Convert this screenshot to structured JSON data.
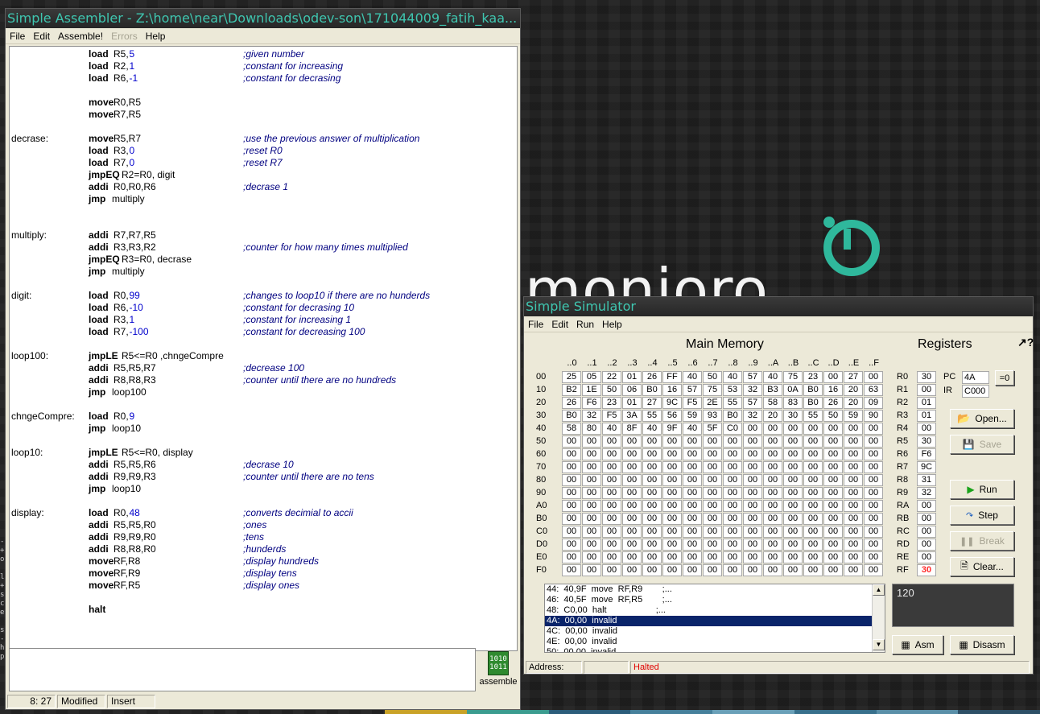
{
  "desktop": {
    "wallpaper_text": "monjoro",
    "taskbar_colors": [
      "#c9a227",
      "#3b9c8f",
      "#2b5d7a",
      "#46809b",
      "#6aa0b8",
      "#38708c",
      "#5a8fa8",
      "#2d4f66"
    ]
  },
  "assembler": {
    "title": "Simple Assembler - Z:\\home\\near\\Downloads\\odev-son\\171044009_fatih_kaa...",
    "menu": [
      "File",
      "Edit",
      "Assemble!",
      "Errors",
      "Help"
    ],
    "code": [
      {
        "label": "",
        "op": "load",
        "args": "R5,",
        "num": "5",
        "comment": ";given number"
      },
      {
        "label": "",
        "op": "load",
        "args": "R2,",
        "num": "1",
        "comment": ";constant for increasing"
      },
      {
        "label": "",
        "op": "load",
        "args": "R6,",
        "num": "-1",
        "comment": ";constant for decrasing"
      },
      {
        "label": "",
        "op": "",
        "args": "",
        "num": "",
        "comment": ""
      },
      {
        "label": "",
        "op": "move",
        "args": "R0,R5",
        "num": "",
        "comment": ""
      },
      {
        "label": "",
        "op": "move",
        "args": "R7,R5",
        "num": "",
        "comment": ""
      },
      {
        "label": "",
        "op": "",
        "args": "",
        "num": "",
        "comment": ""
      },
      {
        "label": "decrase:",
        "op": "move",
        "args": "R5,R7",
        "num": "",
        "comment": ";use the previous answer of multiplication"
      },
      {
        "label": "",
        "op": "load",
        "args": "R3,",
        "num": "0",
        "comment": ";reset R0"
      },
      {
        "label": "",
        "op": "load",
        "args": "R7,",
        "num": "0",
        "comment": ";reset R7"
      },
      {
        "label": "",
        "op": "jmpEQ",
        "args": "R2=R0, digit",
        "num": "",
        "comment": ""
      },
      {
        "label": "",
        "op": "addi",
        "args": "R0,R0,R6",
        "num": "",
        "comment": ";decrase 1"
      },
      {
        "label": "",
        "op": "jmp",
        "args": "multiply",
        "num": "",
        "comment": ""
      },
      {
        "label": "",
        "op": "",
        "args": "",
        "num": "",
        "comment": ""
      },
      {
        "label": "",
        "op": "",
        "args": "",
        "num": "",
        "comment": ""
      },
      {
        "label": "multiply:",
        "op": "addi",
        "args": "R7,R7,R5",
        "num": "",
        "comment": ""
      },
      {
        "label": "",
        "op": "addi",
        "args": "R3,R3,R2",
        "num": "",
        "comment": ";counter for how many times multiplied"
      },
      {
        "label": "",
        "op": "jmpEQ",
        "args": "R3=R0, decrase",
        "num": "",
        "comment": ""
      },
      {
        "label": "",
        "op": "jmp",
        "args": "multiply",
        "num": "",
        "comment": ""
      },
      {
        "label": "",
        "op": "",
        "args": "",
        "num": "",
        "comment": ""
      },
      {
        "label": "digit:",
        "op": "load",
        "args": "R0,",
        "num": "99",
        "comment": ";changes to loop10 if there are no hunderds"
      },
      {
        "label": "",
        "op": "load",
        "args": "R6,",
        "num": "-10",
        "comment": ";constant for decrasing 10"
      },
      {
        "label": "",
        "op": "load",
        "args": "R3,",
        "num": "1",
        "comment": ";constant for increasing 1"
      },
      {
        "label": "",
        "op": "load",
        "args": "R7,",
        "num": "-100",
        "comment": ";constant for decreasing 100"
      },
      {
        "label": "",
        "op": "",
        "args": "",
        "num": "",
        "comment": ""
      },
      {
        "label": "loop100:",
        "op": "jmpLE",
        "args": "R5<=R0 ,chngeCompre",
        "num": "",
        "comment": ""
      },
      {
        "label": "",
        "op": "addi",
        "args": "R5,R5,R7",
        "num": "",
        "comment": ";decrease 100"
      },
      {
        "label": "",
        "op": "addi",
        "args": "R8,R8,R3",
        "num": "",
        "comment": ";counter until there are no hundreds"
      },
      {
        "label": "",
        "op": "jmp",
        "args": "loop100",
        "num": "",
        "comment": ""
      },
      {
        "label": "",
        "op": "",
        "args": "",
        "num": "",
        "comment": ""
      },
      {
        "label": "chngeCompre:",
        "op": "load",
        "args": "R0,",
        "num": "9",
        "comment": ""
      },
      {
        "label": "",
        "op": "jmp",
        "args": "loop10",
        "num": "",
        "comment": ""
      },
      {
        "label": "",
        "op": "",
        "args": "",
        "num": "",
        "comment": ""
      },
      {
        "label": "loop10:",
        "op": "jmpLE",
        "args": "R5<=R0, display",
        "num": "",
        "comment": ""
      },
      {
        "label": "",
        "op": "addi",
        "args": "R5,R5,R6",
        "num": "",
        "comment": ";decrase 10"
      },
      {
        "label": "",
        "op": "addi",
        "args": "R9,R9,R3",
        "num": "",
        "comment": ";counter until there are no tens"
      },
      {
        "label": "",
        "op": "jmp",
        "args": "loop10",
        "num": "",
        "comment": ""
      },
      {
        "label": "",
        "op": "",
        "args": "",
        "num": "",
        "comment": ""
      },
      {
        "label": "display:",
        "op": "load",
        "args": "R0,",
        "num": "48",
        "comment": ";converts decimial to accii"
      },
      {
        "label": "",
        "op": "addi",
        "args": "R5,R5,R0",
        "num": "",
        "comment": ";ones"
      },
      {
        "label": "",
        "op": "addi",
        "args": "R9,R9,R0",
        "num": "",
        "comment": ";tens"
      },
      {
        "label": "",
        "op": "addi",
        "args": "R8,R8,R0",
        "num": "",
        "comment": ";hunderds"
      },
      {
        "label": "",
        "op": "move",
        "args": "RF,R8",
        "num": "",
        "comment": ";display hundreds"
      },
      {
        "label": "",
        "op": "move",
        "args": "RF,R9",
        "num": "",
        "comment": ";display tens"
      },
      {
        "label": "",
        "op": "move",
        "args": "RF,R5",
        "num": "",
        "comment": ";display ones"
      },
      {
        "label": "",
        "op": "",
        "args": "",
        "num": "",
        "comment": ""
      },
      {
        "label": "",
        "op": "halt",
        "args": "",
        "num": "",
        "comment": ""
      }
    ],
    "assemble_label": "assemble",
    "status": {
      "position": "8: 27",
      "modified": "Modified",
      "mode": "Insert"
    }
  },
  "simulator": {
    "title": "Simple Simulator",
    "menu": [
      "File",
      "Edit",
      "Run",
      "Help"
    ],
    "memory_title": "Main Memory",
    "registers_title": "Registers",
    "col_headers": [
      "..0",
      "..1",
      "..2",
      "..3",
      "..4",
      "..5",
      "..6",
      "..7",
      "..8",
      "..9",
      "..A",
      "..B",
      "..C",
      "..D",
      "..E",
      "..F"
    ],
    "row_labels": [
      "00",
      "10",
      "20",
      "30",
      "40",
      "50",
      "60",
      "70",
      "80",
      "90",
      "A0",
      "B0",
      "C0",
      "D0",
      "E0",
      "F0"
    ],
    "memory": [
      [
        "25",
        "05",
        "22",
        "01",
        "26",
        "FF",
        "40",
        "50",
        "40",
        "57",
        "40",
        "75",
        "23",
        "00",
        "27",
        "00"
      ],
      [
        "B2",
        "1E",
        "50",
        "06",
        "B0",
        "16",
        "57",
        "75",
        "53",
        "32",
        "B3",
        "0A",
        "B0",
        "16",
        "20",
        "63"
      ],
      [
        "26",
        "F6",
        "23",
        "01",
        "27",
        "9C",
        "F5",
        "2E",
        "55",
        "57",
        "58",
        "83",
        "B0",
        "26",
        "20",
        "09"
      ],
      [
        "B0",
        "32",
        "F5",
        "3A",
        "55",
        "56",
        "59",
        "93",
        "B0",
        "32",
        "20",
        "30",
        "55",
        "50",
        "59",
        "90"
      ],
      [
        "58",
        "80",
        "40",
        "8F",
        "40",
        "9F",
        "40",
        "5F",
        "C0",
        "00",
        "00",
        "00",
        "00",
        "00",
        "00",
        "00"
      ],
      [
        "00",
        "00",
        "00",
        "00",
        "00",
        "00",
        "00",
        "00",
        "00",
        "00",
        "00",
        "00",
        "00",
        "00",
        "00",
        "00"
      ],
      [
        "00",
        "00",
        "00",
        "00",
        "00",
        "00",
        "00",
        "00",
        "00",
        "00",
        "00",
        "00",
        "00",
        "00",
        "00",
        "00"
      ],
      [
        "00",
        "00",
        "00",
        "00",
        "00",
        "00",
        "00",
        "00",
        "00",
        "00",
        "00",
        "00",
        "00",
        "00",
        "00",
        "00"
      ],
      [
        "00",
        "00",
        "00",
        "00",
        "00",
        "00",
        "00",
        "00",
        "00",
        "00",
        "00",
        "00",
        "00",
        "00",
        "00",
        "00"
      ],
      [
        "00",
        "00",
        "00",
        "00",
        "00",
        "00",
        "00",
        "00",
        "00",
        "00",
        "00",
        "00",
        "00",
        "00",
        "00",
        "00"
      ],
      [
        "00",
        "00",
        "00",
        "00",
        "00",
        "00",
        "00",
        "00",
        "00",
        "00",
        "00",
        "00",
        "00",
        "00",
        "00",
        "00"
      ],
      [
        "00",
        "00",
        "00",
        "00",
        "00",
        "00",
        "00",
        "00",
        "00",
        "00",
        "00",
        "00",
        "00",
        "00",
        "00",
        "00"
      ],
      [
        "00",
        "00",
        "00",
        "00",
        "00",
        "00",
        "00",
        "00",
        "00",
        "00",
        "00",
        "00",
        "00",
        "00",
        "00",
        "00"
      ],
      [
        "00",
        "00",
        "00",
        "00",
        "00",
        "00",
        "00",
        "00",
        "00",
        "00",
        "00",
        "00",
        "00",
        "00",
        "00",
        "00"
      ],
      [
        "00",
        "00",
        "00",
        "00",
        "00",
        "00",
        "00",
        "00",
        "00",
        "00",
        "00",
        "00",
        "00",
        "00",
        "00",
        "00"
      ],
      [
        "00",
        "00",
        "00",
        "00",
        "00",
        "00",
        "00",
        "00",
        "00",
        "00",
        "00",
        "00",
        "00",
        "00",
        "00",
        "00"
      ]
    ],
    "registers": [
      {
        "name": "R0",
        "value": "30"
      },
      {
        "name": "R1",
        "value": "00"
      },
      {
        "name": "R2",
        "value": "01"
      },
      {
        "name": "R3",
        "value": "01"
      },
      {
        "name": "R4",
        "value": "00"
      },
      {
        "name": "R5",
        "value": "30"
      },
      {
        "name": "R6",
        "value": "F6"
      },
      {
        "name": "R7",
        "value": "9C"
      },
      {
        "name": "R8",
        "value": "31"
      },
      {
        "name": "R9",
        "value": "32"
      },
      {
        "name": "RA",
        "value": "00"
      },
      {
        "name": "RB",
        "value": "00"
      },
      {
        "name": "RC",
        "value": "00"
      },
      {
        "name": "RD",
        "value": "00"
      },
      {
        "name": "RE",
        "value": "00"
      },
      {
        "name": "RF",
        "value": "30"
      }
    ],
    "pc_label": "PC",
    "pc_value": "4A",
    "ir_label": "IR",
    "ir_value": "C000",
    "zero_button": "=0",
    "buttons": {
      "open": "Open...",
      "save": "Save",
      "run": "Run",
      "step": "Step",
      "break": "Break",
      "clear": "Clear...",
      "asm": "Asm",
      "disasm": "Disasm"
    },
    "disassembly": [
      "44:  40,9F  move  RF,R9        ;...",
      "46:  40,5F  move  RF,R5        ;...",
      "48:  C0,00  halt                    ;...",
      "4A:  00,00  invalid",
      "4C:  00,00  invalid",
      "4E:  00,00  invalid",
      "50:  00,00  invalid"
    ],
    "selected_line": 3,
    "output": "120",
    "status": {
      "address_label": "Address:",
      "address_value": "",
      "state": "Halted"
    }
  }
}
